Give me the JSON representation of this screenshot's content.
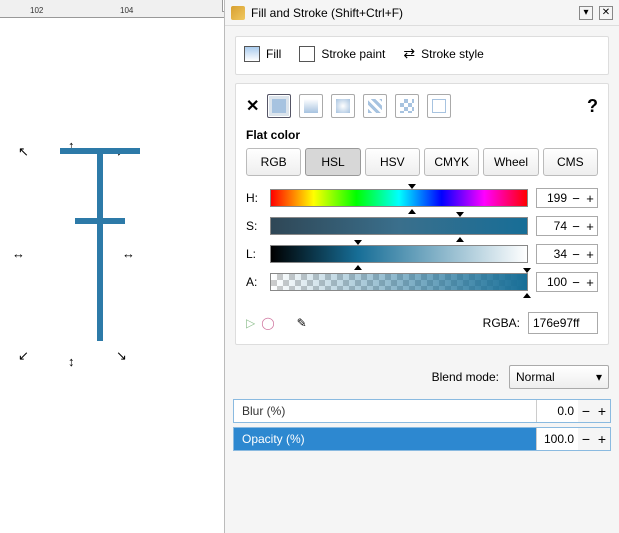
{
  "ruler": {
    "marks": [
      "102",
      "104"
    ]
  },
  "title": "Fill and Stroke (Shift+Ctrl+F)",
  "tabs": {
    "fill": "Fill",
    "stroke_paint": "Stroke paint",
    "stroke_style": "Stroke style",
    "active": "fill"
  },
  "paint": {
    "flat_label": "Flat color"
  },
  "color_models": {
    "rgb": "RGB",
    "hsl": "HSL",
    "hsv": "HSV",
    "cmyk": "CMYK",
    "wheel": "Wheel",
    "cms": "CMS",
    "active": "hsl"
  },
  "sliders": {
    "h": {
      "label": "H:",
      "value": "199",
      "pct": 55
    },
    "s": {
      "label": "S:",
      "value": "74",
      "pct": 74
    },
    "l": {
      "label": "L:",
      "value": "34",
      "pct": 34
    },
    "a": {
      "label": "A:",
      "value": "100",
      "pct": 100
    }
  },
  "rgba": {
    "label": "RGBA:",
    "value": "176e97ff"
  },
  "blend": {
    "label": "Blend mode:",
    "value": "Normal"
  },
  "blur": {
    "label": "Blur (%)",
    "value": "0.0"
  },
  "opacity": {
    "label": "Opacity (%)",
    "value": "100.0"
  }
}
